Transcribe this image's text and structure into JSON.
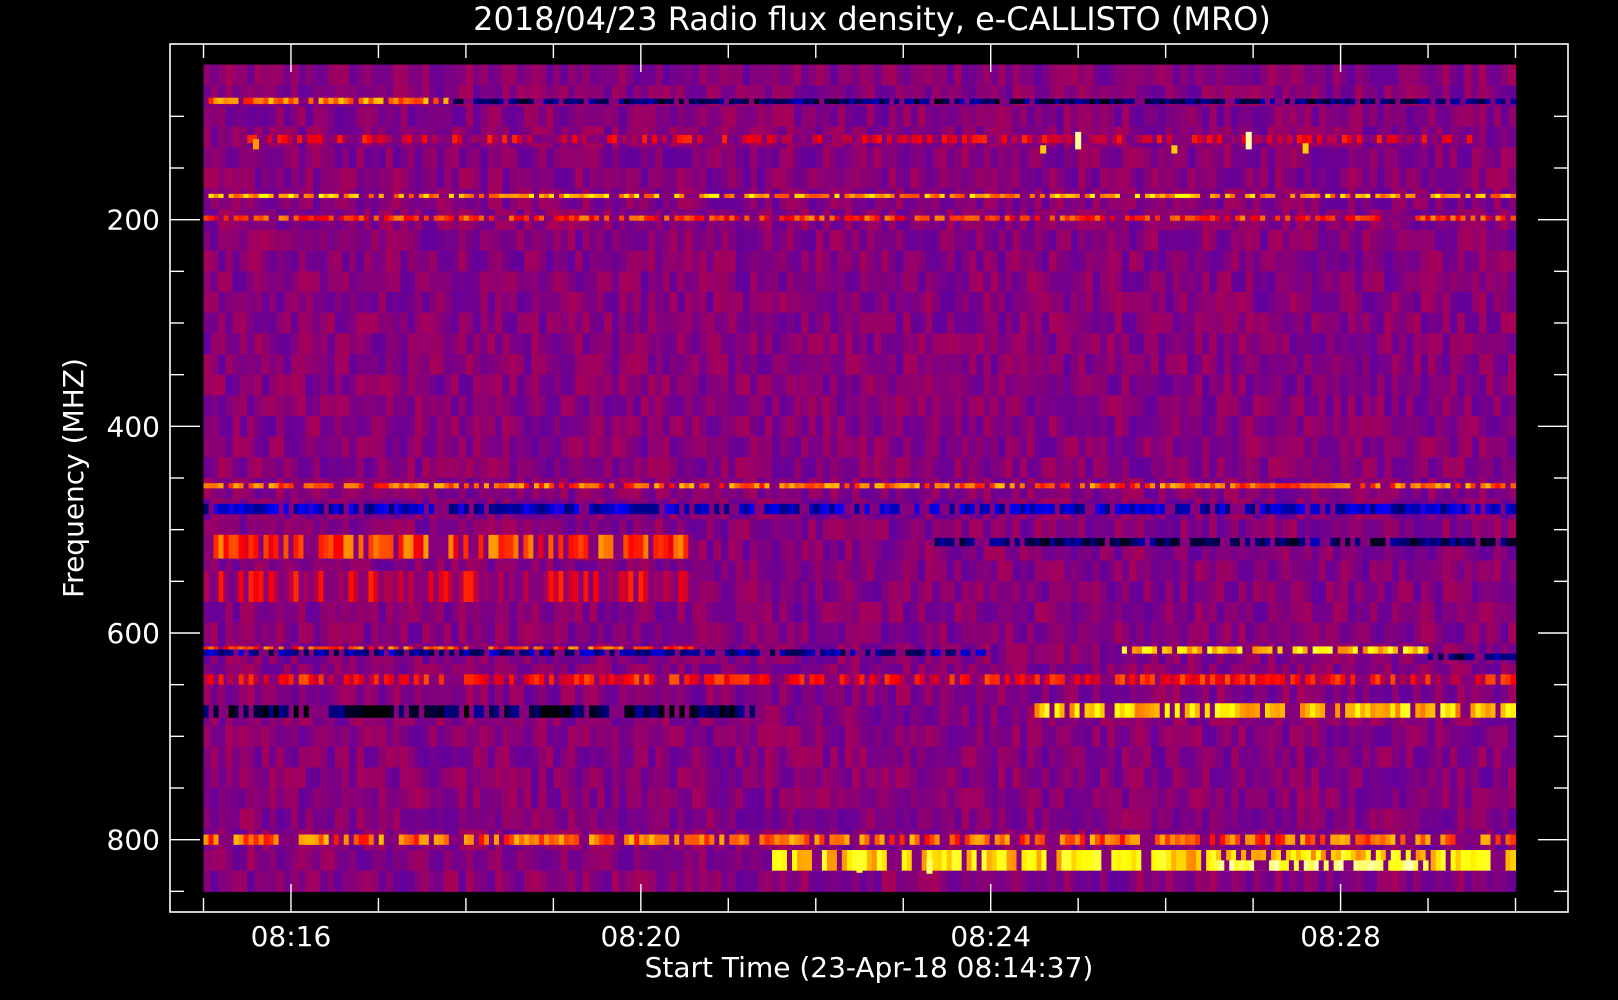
{
  "chart_data": {
    "type": "heatmap",
    "title": "2018/04/23  Radio flux density, e-CALLISTO (MRO)",
    "xlabel": "Start Time (23-Apr-18 08:14:37)",
    "ylabel": "Frequency (MHZ)",
    "x_tick_labels": [
      "08:16",
      "08:20",
      "08:24",
      "08:28"
    ],
    "x_ticks_min": [
      16,
      20,
      24,
      28
    ],
    "x_minor_min": [
      15,
      16,
      17,
      18,
      19,
      20,
      21,
      22,
      23,
      24,
      25,
      26,
      27,
      28,
      29,
      30
    ],
    "xlim_min": [
      14.617,
      30.6
    ],
    "data_xlim_min": [
      15.0,
      30.0
    ],
    "y_tick_labels": [
      "200",
      "400",
      "600",
      "800"
    ],
    "y_ticks": [
      200,
      400,
      600,
      800
    ],
    "y_minor": [
      100,
      150,
      200,
      250,
      300,
      350,
      400,
      450,
      500,
      550,
      600,
      650,
      700,
      750,
      800,
      850
    ],
    "ylim": [
      870,
      30
    ],
    "data_ylim": [
      850,
      50
    ],
    "y_inverted": true,
    "colormap": [
      "#000000",
      "#0000ff",
      "#ff0000",
      "#ffff00",
      "#ffffff"
    ],
    "background_value": 0.38,
    "bands": [
      {
        "f0": 82,
        "f1": 88,
        "t0": 15.0,
        "t1": 17.8,
        "v": 0.62
      },
      {
        "f0": 83,
        "f1": 88,
        "t0": 17.8,
        "t1": 30.0,
        "v": 0.1
      },
      {
        "f0": 118,
        "f1": 126,
        "t0": 15.5,
        "t1": 29.5,
        "v": 0.45
      },
      {
        "f0": 175,
        "f1": 179,
        "t0": 15.0,
        "t1": 30.0,
        "v": 0.66
      },
      {
        "f0": 196,
        "f1": 201,
        "t0": 15.0,
        "t1": 30.0,
        "v": 0.55
      },
      {
        "f0": 455,
        "f1": 460,
        "t0": 15.0,
        "t1": 30.0,
        "v": 0.6
      },
      {
        "f0": 475,
        "f1": 485,
        "t0": 15.0,
        "t1": 30.0,
        "v": 0.2
      },
      {
        "f0": 505,
        "f1": 528,
        "t0": 15.0,
        "t1": 20.6,
        "v": 0.56
      },
      {
        "f0": 508,
        "f1": 516,
        "t0": 23.3,
        "t1": 30.0,
        "v": 0.1
      },
      {
        "f0": 540,
        "f1": 570,
        "t0": 15.0,
        "t1": 20.6,
        "v": 0.45
      },
      {
        "f0": 613,
        "f1": 618,
        "t0": 15.0,
        "t1": 20.6,
        "v": 0.58
      },
      {
        "f0": 613,
        "f1": 620,
        "t0": 25.5,
        "t1": 29.0,
        "v": 0.72
      },
      {
        "f0": 616,
        "f1": 622,
        "t0": 15.0,
        "t1": 24.0,
        "v": 0.15
      },
      {
        "f0": 620,
        "f1": 626,
        "t0": 29.0,
        "t1": 30.0,
        "v": 0.1
      },
      {
        "f0": 640,
        "f1": 650,
        "t0": 15.0,
        "t1": 30.0,
        "v": 0.5
      },
      {
        "f0": 670,
        "f1": 682,
        "t0": 15.0,
        "t1": 21.3,
        "v": 0.06
      },
      {
        "f0": 668,
        "f1": 682,
        "t0": 24.5,
        "t1": 30.0,
        "v": 0.7
      },
      {
        "f0": 795,
        "f1": 805,
        "t0": 15.0,
        "t1": 30.0,
        "v": 0.6
      },
      {
        "f0": 810,
        "f1": 830,
        "t0": 21.5,
        "t1": 30.0,
        "v": 0.72
      },
      {
        "f0": 820,
        "f1": 830,
        "t0": 26.5,
        "t1": 29.0,
        "v": 0.85
      }
    ],
    "bursts": [
      {
        "t": 25.0,
        "f0": 115,
        "f1": 132,
        "v": 0.9
      },
      {
        "t": 26.95,
        "f0": 115,
        "f1": 132,
        "v": 0.92
      },
      {
        "t": 24.6,
        "f0": 128,
        "f1": 136,
        "v": 0.7
      },
      {
        "t": 26.1,
        "f0": 128,
        "f1": 136,
        "v": 0.7
      },
      {
        "t": 27.6,
        "f0": 126,
        "f1": 136,
        "v": 0.7
      },
      {
        "t": 15.6,
        "f0": 122,
        "f1": 132,
        "v": 0.65
      },
      {
        "t": 23.3,
        "f0": 819,
        "f1": 833,
        "v": 0.85
      },
      {
        "t": 22.5,
        "f0": 818,
        "f1": 832,
        "v": 0.8
      }
    ]
  }
}
